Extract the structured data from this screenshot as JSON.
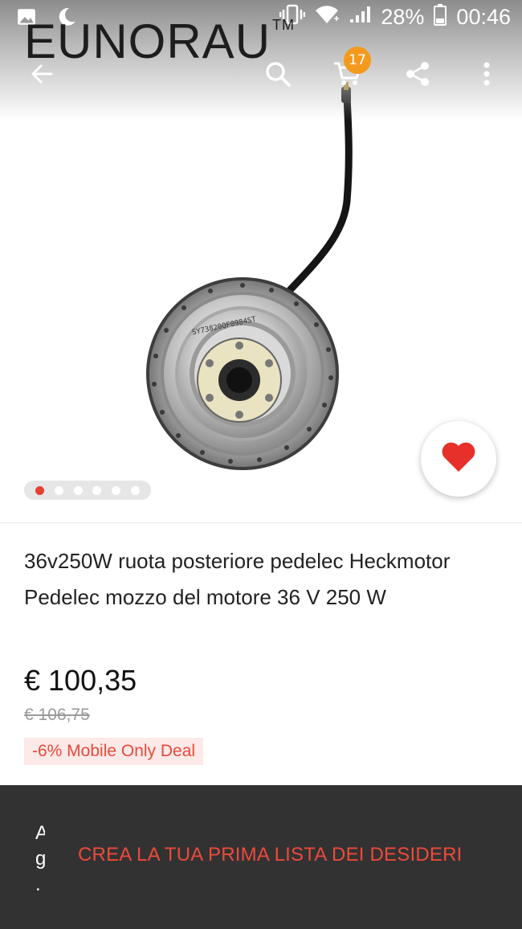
{
  "status_bar": {
    "battery_percent": "28%",
    "time": "00:46",
    "icons": [
      "image-icon",
      "moon-icon",
      "vibrate-icon",
      "wifi-icon",
      "signal-icon",
      "battery-icon"
    ]
  },
  "brand": {
    "name": "EUNORAU",
    "trademark": "TM"
  },
  "toolbar": {
    "icons": [
      "back-arrow-icon",
      "search-icon",
      "cart-icon",
      "share-icon",
      "more-vert-icon"
    ],
    "cart_count": "17"
  },
  "gallery": {
    "dot_count": 6,
    "active_index": 0,
    "image_subject": "hub-motor-image",
    "motor_serial": "SY73820QF0984ST"
  },
  "product": {
    "title": "36v250W ruota posteriore pedelec Heckmotor Pedelec mozzo del motore 36 V 250 W",
    "price": "€ 100,35",
    "old_price": "€ 106,75",
    "deal": "-6% Mobile Only Deal",
    "favorite_icon": "heart-icon"
  },
  "snackbar": {
    "message_partial": "A g .",
    "action": "CREA LA TUA PRIMA LISTA DEI DESIDERI"
  },
  "colors": {
    "accent": "#e8402f",
    "badge": "#f39a1e",
    "snackbar_bg": "#323232",
    "deal_bg": "#fde9e7"
  }
}
